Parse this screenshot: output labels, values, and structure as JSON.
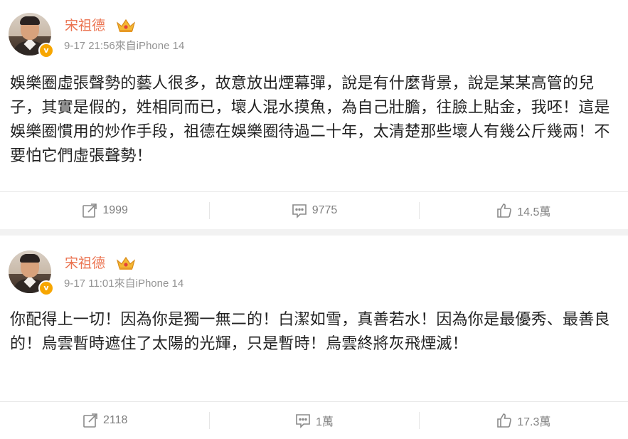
{
  "posts": [
    {
      "username": "宋祖德",
      "meta": "9-17 21:56來自iPhone 14",
      "verified_badge": "v",
      "text": "娛樂圈虛張聲勢的藝人很多，故意放出煙幕彈，說是有什麼背景，說是某某高管的兒子，其實是假的，姓相同而已，壞人混水摸魚，為自己壯膽，往臉上貼金，我呸！這是娛樂圈慣用的炒作手段，祖德在娛樂圈待過二十年，太清楚那些壞人有幾公斤幾兩！不要怕它們虛張聲勢！",
      "actions": {
        "repost": "1999",
        "comment": "9775",
        "like": "14.5萬"
      }
    },
    {
      "username": "宋祖德",
      "meta": "9-17 11:01來自iPhone 14",
      "verified_badge": "v",
      "text": "你配得上一切！因為你是獨一無二的！白潔如雪，真善若水！因為你是最優秀、最善良的！烏雲暫時遮住了太陽的光輝，只是暫時！烏雲終將灰飛煙滅！",
      "actions": {
        "repost": "2118",
        "comment": "1萬",
        "like": "17.3萬"
      }
    }
  ],
  "colors": {
    "username": "#eb7350",
    "meta": "#939393",
    "body_text": "#222222",
    "action_text": "#808080",
    "badge": "#f7a600",
    "separator": "#f2f2f2"
  },
  "icons": [
    "repost-icon",
    "comment-icon",
    "like-icon",
    "crown-icon",
    "verified-badge-icon"
  ]
}
